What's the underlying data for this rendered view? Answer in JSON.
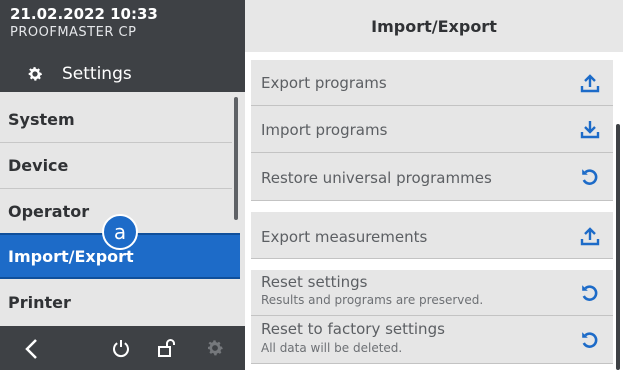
{
  "header": {
    "datetime": "21.02.2022 10:33",
    "device_name": "PROOFMASTER CP",
    "settings_label": "Settings"
  },
  "menu": {
    "items": [
      {
        "label": "System"
      },
      {
        "label": "Device"
      },
      {
        "label": "Operator"
      },
      {
        "label": "Import/Export",
        "active": true
      },
      {
        "label": "Printer"
      }
    ]
  },
  "annotation": {
    "marker": "a"
  },
  "footer": {
    "icons": [
      "back-arrow-icon",
      "power-icon",
      "unlock-icon",
      "gear-icon"
    ]
  },
  "panel": {
    "title": "Import/Export",
    "items": [
      {
        "label": "Export programs",
        "icon": "upload-icon"
      },
      {
        "label": "Import programs",
        "icon": "download-icon"
      },
      {
        "label": "Restore universal programmes",
        "icon": "reset-icon"
      },
      {
        "label": "Export measurements",
        "icon": "upload-icon"
      },
      {
        "label": "Reset settings",
        "sublabel": "Results and programs are preserved.",
        "icon": "reset-icon"
      },
      {
        "label": "Reset to factory settings",
        "sublabel": "All data will be deleted.",
        "icon": "reset-icon"
      }
    ]
  },
  "colors": {
    "accent": "#1d6bc8",
    "dark_bar": "#3e4145",
    "panel_bg": "#e6e6e6"
  }
}
